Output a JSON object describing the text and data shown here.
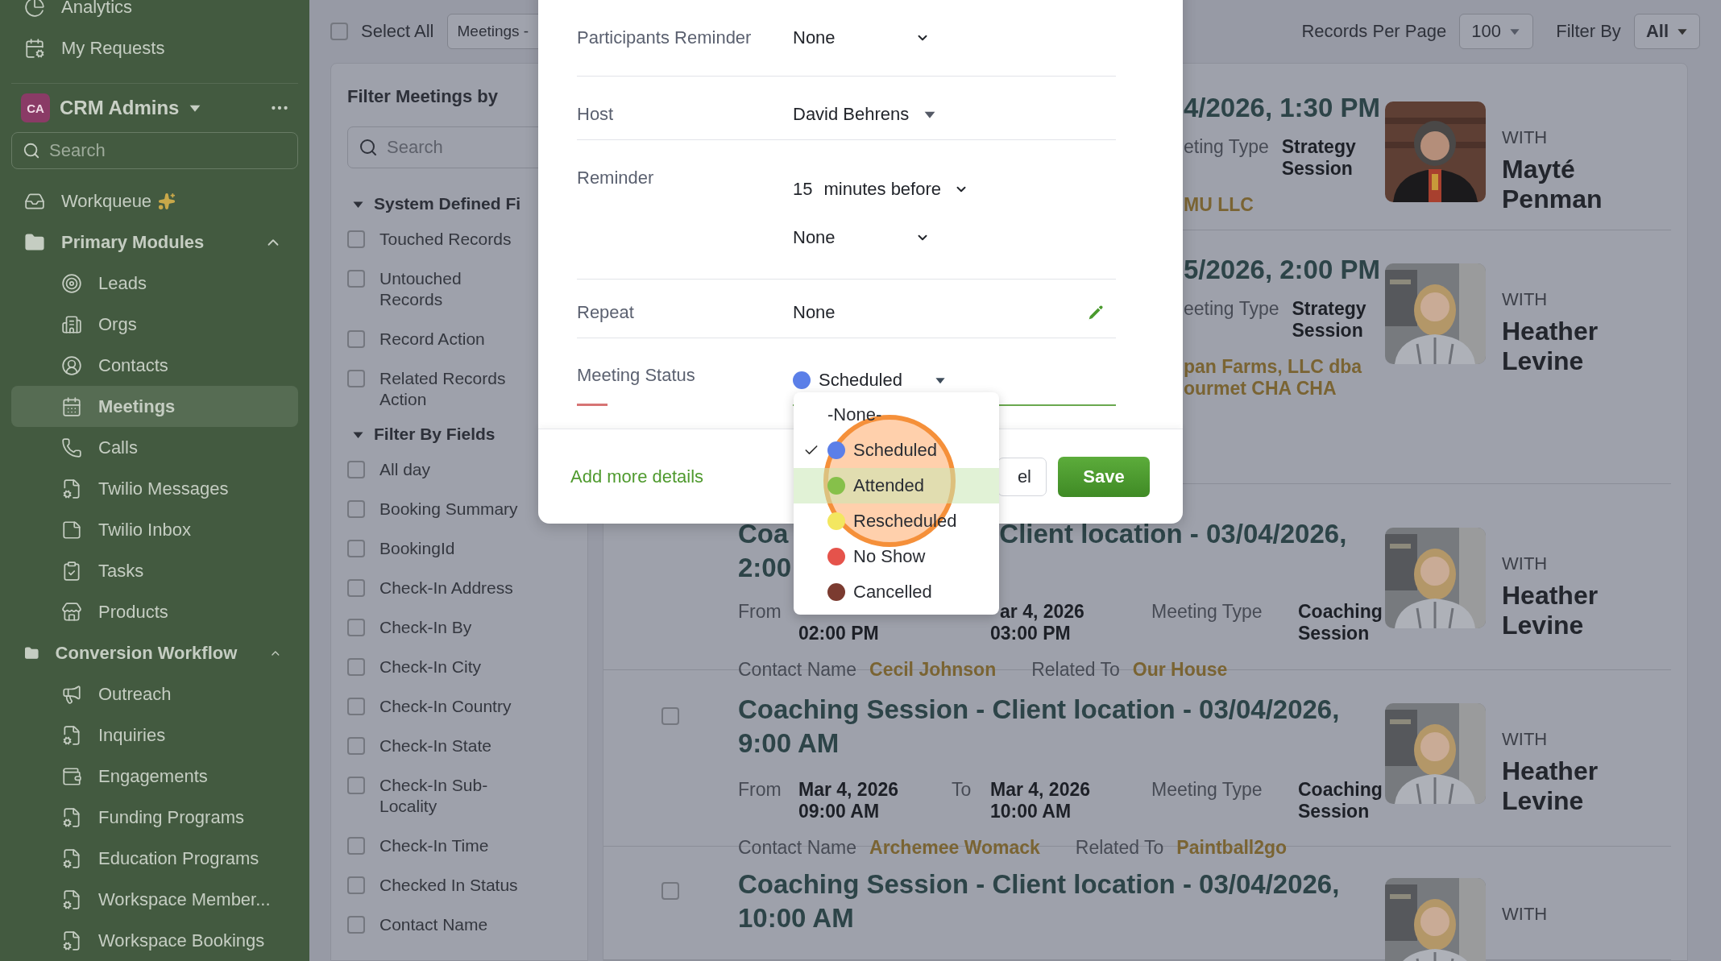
{
  "sidebar": {
    "top_items": [
      {
        "label": "Analytics",
        "selected": false
      },
      {
        "label": "My Requests",
        "selected": false
      }
    ],
    "workspace": {
      "initials": "CA",
      "name": "CRM Admins"
    },
    "search": {
      "placeholder": "Search"
    },
    "workqueue": {
      "label": "Workqueue",
      "selected": false
    },
    "groups": [
      {
        "label": "Primary Modules",
        "expanded": true,
        "children": [
          {
            "label": "Leads",
            "selected": false
          },
          {
            "label": "Orgs",
            "selected": false
          },
          {
            "label": "Contacts",
            "selected": false
          },
          {
            "label": "Meetings",
            "selected": true
          },
          {
            "label": "Calls",
            "selected": false
          },
          {
            "label": "Twilio Messages",
            "selected": false
          },
          {
            "label": "Twilio Inbox",
            "selected": false
          },
          {
            "label": "Tasks",
            "selected": false
          },
          {
            "label": "Products",
            "selected": false
          }
        ]
      },
      {
        "label": "Conversion Workflow",
        "expanded": true,
        "children": [
          {
            "label": "Outreach",
            "selected": false
          },
          {
            "label": "Inquiries",
            "selected": false
          },
          {
            "label": "Engagements",
            "selected": false
          },
          {
            "label": "Funding Programs",
            "selected": false
          },
          {
            "label": "Education Programs",
            "selected": false
          },
          {
            "label": "Workspace Member...",
            "selected": false
          },
          {
            "label": "Workspace Bookings",
            "selected": false
          }
        ]
      }
    ]
  },
  "toolbar": {
    "select_all": {
      "label": "Select All",
      "checked": false
    },
    "view_select": "Meetings -",
    "records_per_page": {
      "label": "Records Per Page",
      "value": "100"
    },
    "filter_by": {
      "label": "Filter By",
      "value": "All"
    }
  },
  "filter_panel": {
    "title": "Filter Meetings by",
    "search": {
      "placeholder": "Search"
    },
    "sections": [
      {
        "title": "System Defined Fi",
        "expanded": true,
        "options": [
          {
            "label": "Touched Records",
            "checked": false
          },
          {
            "label": "Untouched Records",
            "checked": false
          },
          {
            "label": "Record Action",
            "checked": false
          },
          {
            "label": "Related Records Action",
            "checked": false
          }
        ]
      },
      {
        "title": "Filter By Fields",
        "expanded": true,
        "options": [
          {
            "label": "All day",
            "checked": false
          },
          {
            "label": "Booking Summary",
            "checked": false
          },
          {
            "label": "BookingId",
            "checked": false
          },
          {
            "label": "Check-In Address",
            "checked": false
          },
          {
            "label": "Check-In By",
            "checked": false
          },
          {
            "label": "Check-In City",
            "checked": false
          },
          {
            "label": "Check-In Country",
            "checked": false
          },
          {
            "label": "Check-In State",
            "checked": false
          },
          {
            "label": "Check-In Sub-Locality",
            "checked": false
          },
          {
            "label": "Check-In Time",
            "checked": false
          },
          {
            "label": "Checked In Status",
            "checked": false
          },
          {
            "label": "Contact Name",
            "checked": false
          }
        ]
      }
    ]
  },
  "records": [
    {
      "kind": "partial",
      "title": "4/2026, 1:30 PM",
      "type_label": "eting Type",
      "type_value": "Strategy Session",
      "related_lines": [
        "MU LLC"
      ],
      "with_label": "WITH",
      "name": "Mayté Penman"
    },
    {
      "kind": "partial",
      "title": "5/2026, 2:00 PM",
      "type_label": "eeting Type",
      "type_value": "Strategy Session",
      "related_lines": [
        "pan Farms, LLC dba",
        "ourmet CHA CHA"
      ],
      "with_label": "WITH",
      "name": "Heather Levine"
    },
    {
      "kind": "covered",
      "title_parts": [
        "Coa",
        "Client location - 03/04/2026,",
        "2:00"
      ],
      "from_label": "From",
      "from_lines": [
        "02:00 PM"
      ],
      "to_lines": [
        "ar 4, 2026",
        "03:00 PM"
      ],
      "type_label": "Meeting Type",
      "type_value": "Coaching Session",
      "contact_label": "Contact Name",
      "contact": "Cecil Johnson",
      "related_label": "Related To",
      "related": "Our House",
      "with_label": "WITH",
      "name": "Heather Levine"
    },
    {
      "kind": "full",
      "checked": false,
      "title": "Coaching Session - Client location - 03/04/2026, 9:00 AM",
      "from_label": "From",
      "from_lines": [
        "Mar 4, 2026",
        "09:00 AM"
      ],
      "to_label": "To",
      "to_lines": [
        "Mar 4, 2026",
        "10:00 AM"
      ],
      "type_label": "Meeting Type",
      "type_value": "Coaching Session",
      "contact_label": "Contact Name",
      "contact": "Archemee Womack",
      "related_label": "Related To",
      "related": "Paintball2go",
      "with_label": "WITH",
      "name": "Heather Levine"
    },
    {
      "kind": "full",
      "checked": false,
      "title": "Coaching Session - Client location - 03/04/2026, 10:00 AM",
      "with_label": "WITH"
    }
  ],
  "modal": {
    "fields": [
      {
        "label": "Participants Reminder",
        "kind": "select",
        "value": "None",
        "focused": false
      },
      {
        "label": "Host",
        "kind": "user_select",
        "value": "David Behrens",
        "focused": false
      },
      {
        "label": "Reminder",
        "kind": "reminder",
        "number": "15",
        "unit": "minutes before",
        "value": "None",
        "focused": false
      },
      {
        "label": "Repeat",
        "kind": "editable",
        "value": "None",
        "focused": false
      },
      {
        "label": "Meeting Status",
        "kind": "status",
        "value": "Scheduled",
        "color": "#5b7fe8",
        "focused": true
      }
    ],
    "footer": {
      "link": "Add more details",
      "cancel": "el",
      "save": "Save"
    }
  },
  "status_menu": {
    "options": [
      {
        "label": "-None-",
        "selected": false,
        "highlighted": false
      },
      {
        "label": "Scheduled",
        "color": "#5b7fe8",
        "selected": true,
        "highlighted": false
      },
      {
        "label": "Attended",
        "color": "#86c04a",
        "selected": false,
        "highlighted": true
      },
      {
        "label": "Rescheduled",
        "color": "#f3e760",
        "selected": false,
        "highlighted": false
      },
      {
        "label": "No Show",
        "color": "#e5534b",
        "selected": false,
        "highlighted": false
      },
      {
        "label": "Cancelled",
        "color": "#7b3b30",
        "selected": false,
        "highlighted": false
      }
    ]
  }
}
